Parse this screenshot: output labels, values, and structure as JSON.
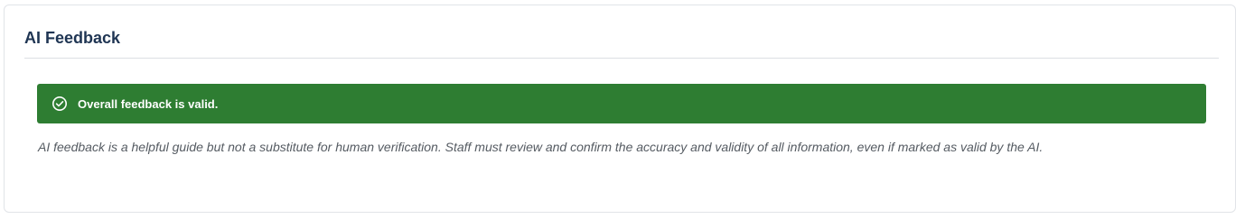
{
  "card": {
    "title": "AI Feedback"
  },
  "alert": {
    "icon": "check-circle-icon",
    "message": "Overall feedback is valid.",
    "background_color": "#2e7d32"
  },
  "disclaimer": {
    "text": "AI feedback is a helpful guide but not a substitute for human verification. Staff must review and confirm the accuracy and validity of all information, even if marked as valid by the AI."
  }
}
